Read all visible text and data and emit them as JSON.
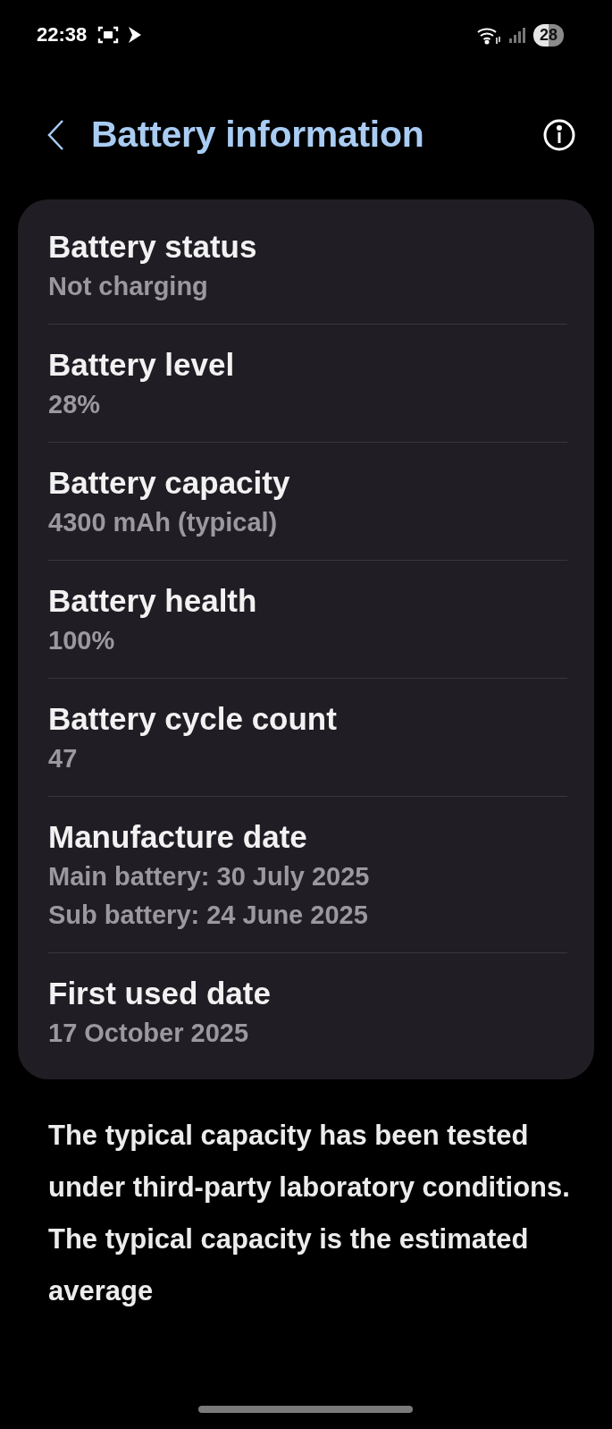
{
  "status_bar": {
    "time": "22:38",
    "battery": "28"
  },
  "header": {
    "title": "Battery information"
  },
  "items": [
    {
      "label": "Battery status",
      "values": [
        "Not charging"
      ]
    },
    {
      "label": "Battery level",
      "values": [
        "28%"
      ]
    },
    {
      "label": "Battery capacity",
      "values": [
        "4300 mAh (typical)"
      ]
    },
    {
      "label": "Battery health",
      "values": [
        "100%"
      ]
    },
    {
      "label": "Battery cycle count",
      "values": [
        "47"
      ]
    },
    {
      "label": "Manufacture date",
      "values": [
        "Main battery: 30 July 2025",
        "Sub battery: 24 June 2025"
      ]
    },
    {
      "label": "First used date",
      "values": [
        "17 October 2025"
      ]
    }
  ],
  "note": "The typical capacity has been tested under third-party laboratory conditions. The typical capacity is the estimated average"
}
